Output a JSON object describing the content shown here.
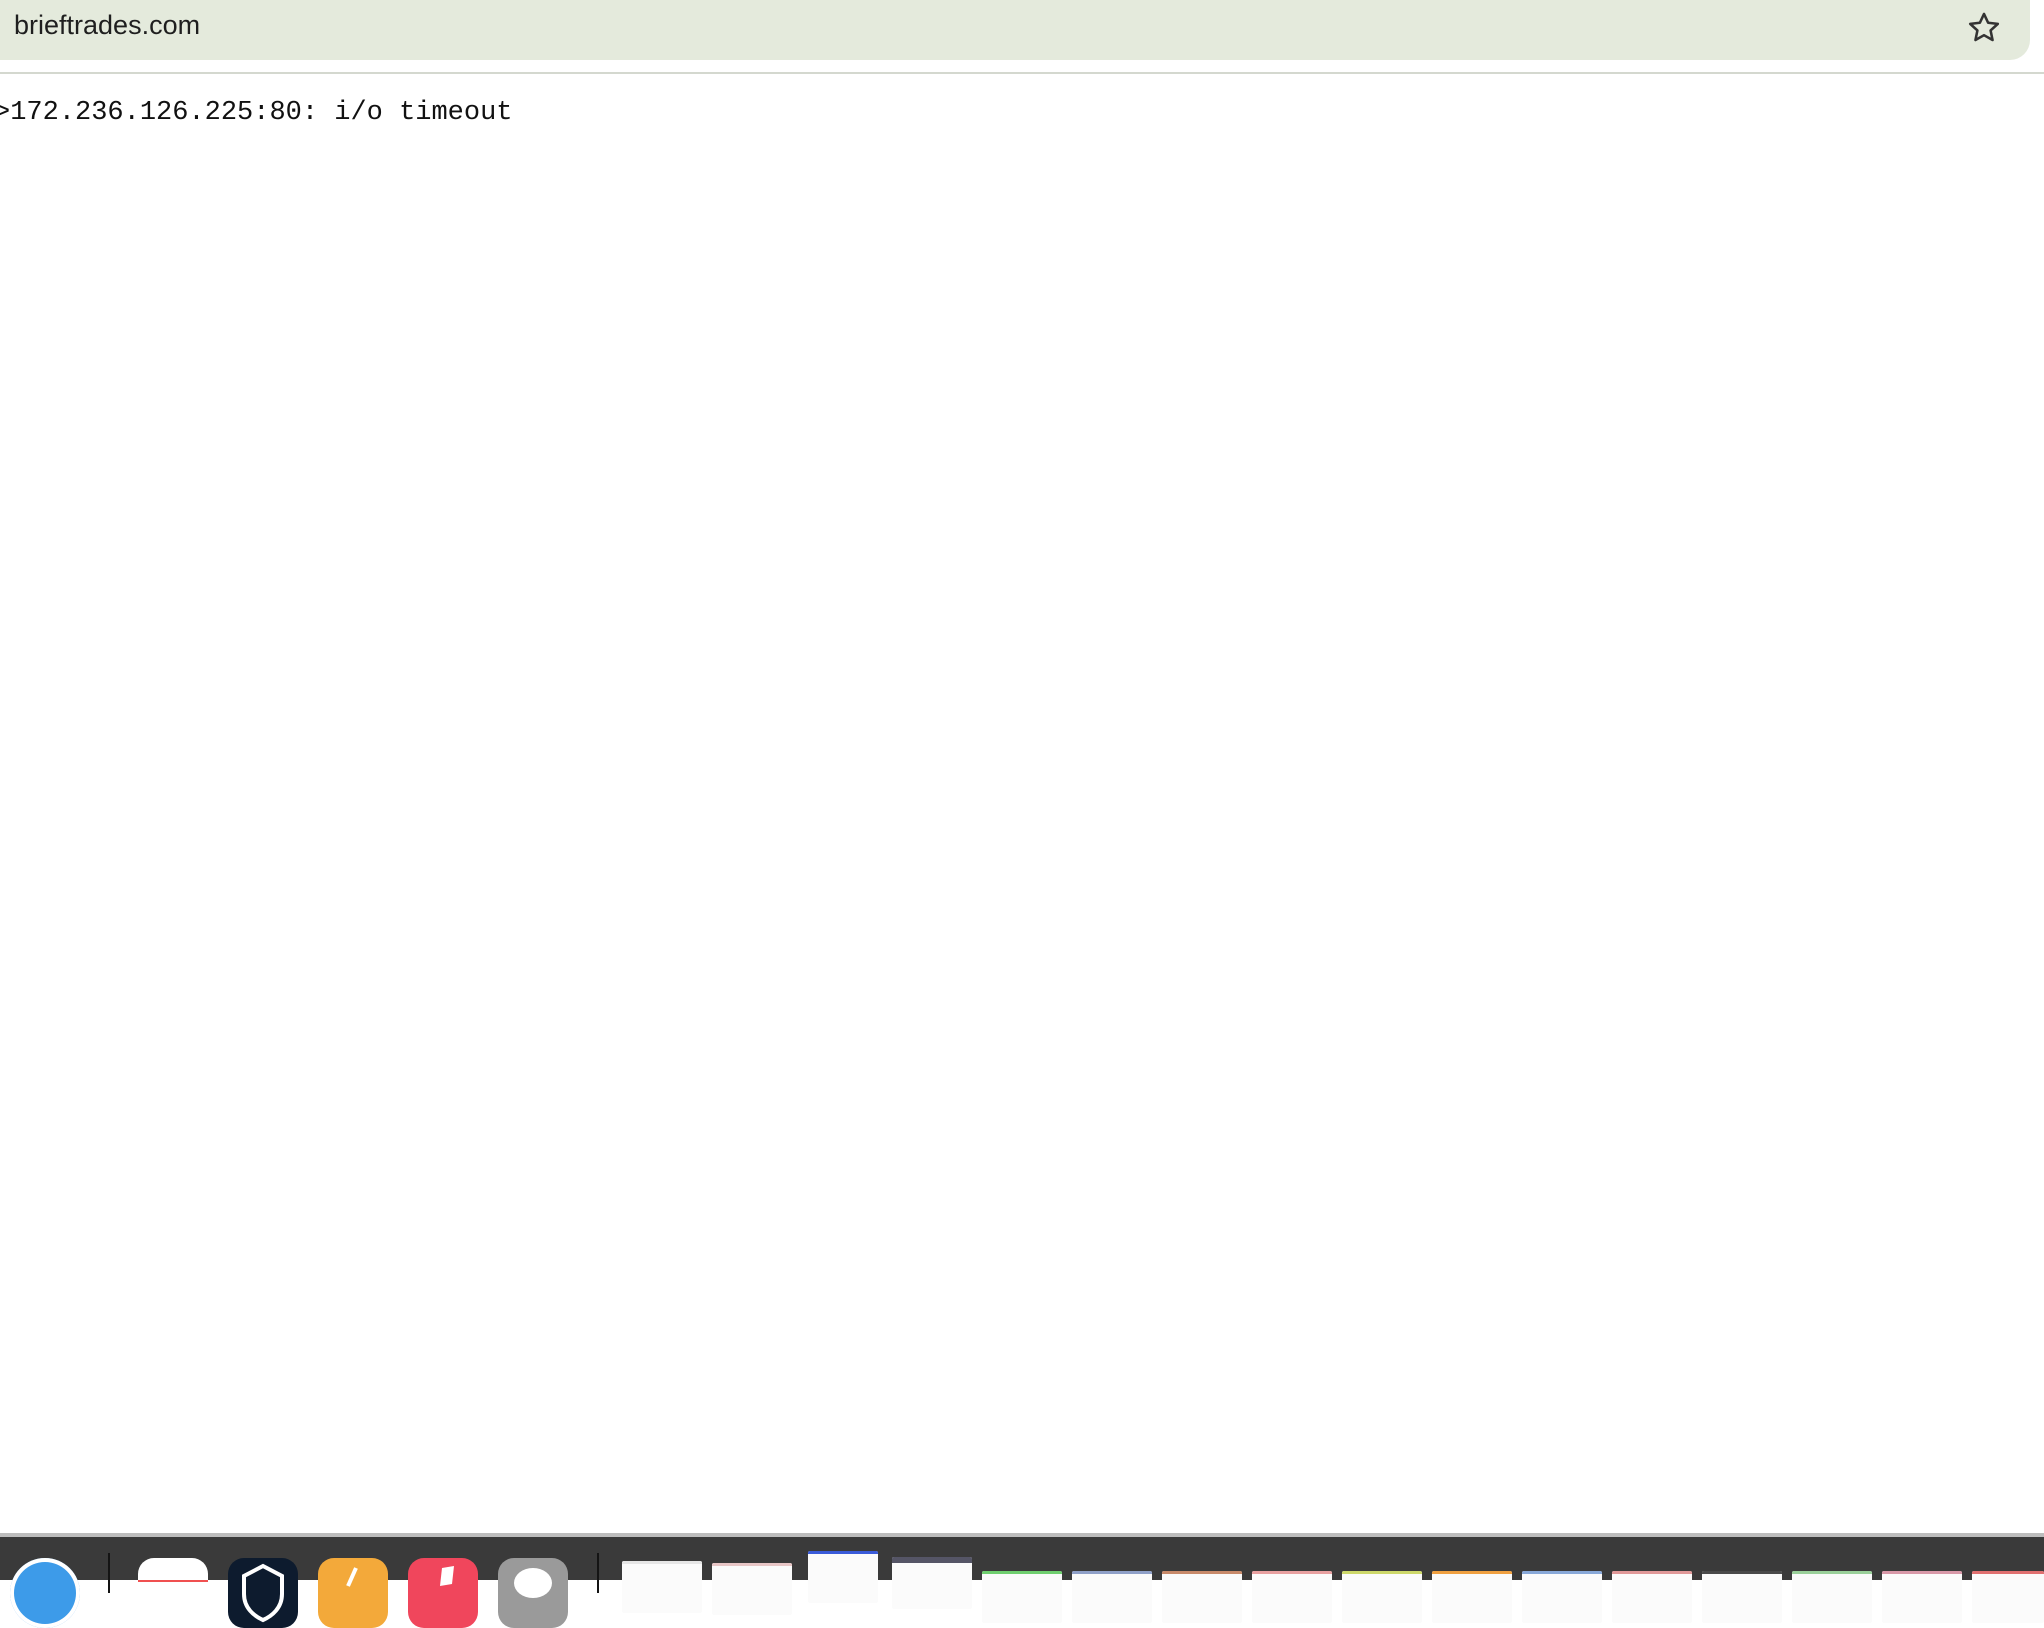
{
  "browser": {
    "url": "brieftrades.com",
    "bookmark_icon": "star-icon"
  },
  "page": {
    "message": ">172.236.126.225:80: i/o timeout"
  },
  "dock": {
    "apps": [
      {
        "icon": "safari-icon",
        "color": "#3d9be9"
      },
      {
        "icon": "calendar-icon",
        "color": "#ffffff"
      },
      {
        "icon": "shield-app-icon",
        "color": "#0d1b2e"
      },
      {
        "icon": "notes-app-icon",
        "color": "#f3a93a"
      },
      {
        "icon": "music-icon",
        "color": "#f0465c"
      },
      {
        "icon": "messages-app-icon",
        "color": "#9a9a9a"
      }
    ],
    "thumbnails": [
      {
        "accent": "#e6e6e6"
      },
      {
        "accent": "#e8c6c6"
      },
      {
        "accent": "#3a5bd9"
      },
      {
        "accent": "#555566"
      },
      {
        "accent": "#6fcf6f"
      },
      {
        "accent": "#8fa0c8"
      },
      {
        "accent": "#c88a6a"
      },
      {
        "accent": "#e8a0a0"
      },
      {
        "accent": "#cdd86a"
      },
      {
        "accent": "#f0a040"
      },
      {
        "accent": "#88a8d8"
      },
      {
        "accent": "#e09898"
      },
      {
        "accent": "#4a4a4a"
      },
      {
        "accent": "#9ad09a"
      },
      {
        "accent": "#d898a8"
      },
      {
        "accent": "#e07070"
      }
    ]
  }
}
